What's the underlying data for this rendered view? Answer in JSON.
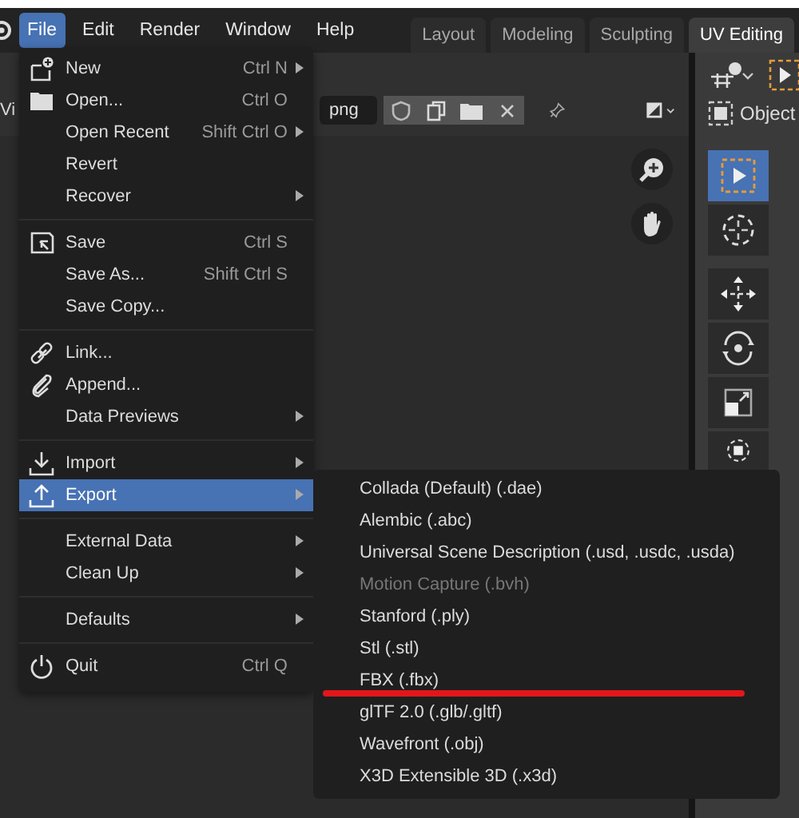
{
  "menubar": {
    "items": [
      {
        "label": "File",
        "selected": true
      },
      {
        "label": "Edit",
        "selected": false
      },
      {
        "label": "Render",
        "selected": false
      },
      {
        "label": "Window",
        "selected": false
      },
      {
        "label": "Help",
        "selected": false
      }
    ]
  },
  "workspaces": [
    {
      "label": "Layout",
      "selected": false
    },
    {
      "label": "Modeling",
      "selected": false
    },
    {
      "label": "Sculpting",
      "selected": false
    },
    {
      "label": "UV Editing",
      "selected": true
    }
  ],
  "image_editor": {
    "view_menu": "Vi",
    "image_name": "png"
  },
  "viewport": {
    "mode": "Object",
    "tools": [
      {
        "kind": "select",
        "selected": true
      },
      {
        "kind": "cursor",
        "selected": false
      },
      {
        "kind": "move",
        "selected": false
      },
      {
        "kind": "rotate",
        "selected": false
      },
      {
        "kind": "scale",
        "selected": false
      },
      {
        "kind": "transform",
        "selected": false
      }
    ]
  },
  "file_menu": {
    "sections": [
      [
        {
          "kind": "new",
          "label": "New",
          "shortcut": "Ctrl N",
          "submenu": true,
          "highlighted": false
        },
        {
          "kind": "open",
          "label": "Open...",
          "shortcut": "Ctrl O",
          "submenu": false,
          "highlighted": false
        },
        {
          "kind": "plain",
          "label": "Open Recent",
          "shortcut": "Shift Ctrl O",
          "submenu": true,
          "highlighted": false
        },
        {
          "kind": "plain",
          "label": "Revert",
          "submenu": false,
          "highlighted": false
        },
        {
          "kind": "plain",
          "label": "Recover",
          "submenu": true,
          "highlighted": false
        }
      ],
      [
        {
          "kind": "save",
          "label": "Save",
          "shortcut": "Ctrl S",
          "submenu": false,
          "highlighted": false
        },
        {
          "kind": "plain",
          "label": "Save As...",
          "shortcut": "Shift Ctrl S",
          "submenu": false,
          "highlighted": false
        },
        {
          "kind": "plain",
          "label": "Save Copy...",
          "submenu": false,
          "highlighted": false
        }
      ],
      [
        {
          "kind": "link",
          "label": "Link...",
          "submenu": false,
          "highlighted": false
        },
        {
          "kind": "append",
          "label": "Append...",
          "submenu": false,
          "highlighted": false
        },
        {
          "kind": "plain",
          "label": "Data Previews",
          "submenu": true,
          "highlighted": false
        }
      ],
      [
        {
          "kind": "import",
          "label": "Import",
          "submenu": true,
          "highlighted": false
        },
        {
          "kind": "export",
          "label": "Export",
          "submenu": true,
          "highlighted": true
        }
      ],
      [
        {
          "kind": "plain",
          "label": "External Data",
          "submenu": true,
          "highlighted": false
        },
        {
          "kind": "plain",
          "label": "Clean Up",
          "submenu": true,
          "highlighted": false
        }
      ],
      [
        {
          "kind": "plain",
          "label": "Defaults",
          "submenu": true,
          "highlighted": false
        }
      ],
      [
        {
          "kind": "quit",
          "label": "Quit",
          "shortcut": "Ctrl Q",
          "submenu": false,
          "highlighted": false
        }
      ]
    ]
  },
  "export_menu": {
    "items": [
      {
        "label": "Collada (Default) (.dae)",
        "disabled": false,
        "underlined": false
      },
      {
        "label": "Alembic (.abc)",
        "disabled": false,
        "underlined": false
      },
      {
        "label": "Universal Scene Description (.usd, .usdc, .usda)",
        "disabled": false,
        "underlined": false
      },
      {
        "label": "Motion Capture (.bvh)",
        "disabled": true,
        "underlined": false
      },
      {
        "label": "Stanford (.ply)",
        "disabled": false,
        "underlined": false
      },
      {
        "label": "Stl (.stl)",
        "disabled": false,
        "underlined": false
      },
      {
        "label": "FBX (.fbx)",
        "disabled": false,
        "underlined": true
      },
      {
        "label": "glTF 2.0 (.glb/.gltf)",
        "disabled": false,
        "underlined": false
      },
      {
        "label": "Wavefront (.obj)",
        "disabled": false,
        "underlined": false
      },
      {
        "label": "X3D Extensible 3D (.x3d)",
        "disabled": false,
        "underlined": false
      }
    ]
  }
}
